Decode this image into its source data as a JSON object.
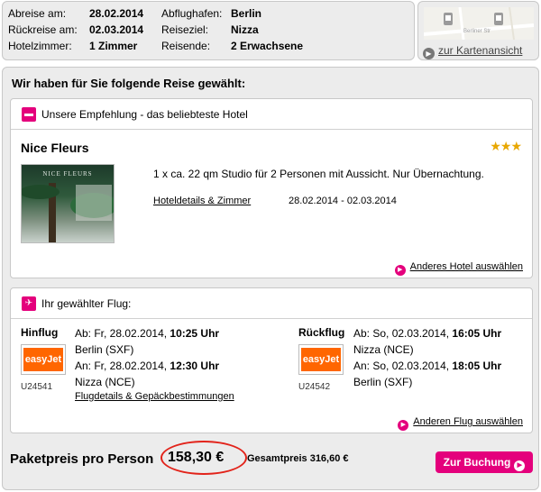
{
  "summary": {
    "depart_label": "Abreise am:",
    "depart_value": "28.02.2014",
    "airport_label": "Abflughafen:",
    "airport_value": "Berlin",
    "return_label": "Rückreise am:",
    "return_value": "02.03.2014",
    "dest_label": "Reiseziel:",
    "dest_value": "Nizza",
    "rooms_label": "Hotelzimmer:",
    "rooms_value": "1 Zimmer",
    "travelers_label": "Reisende:",
    "travelers_value": "2 Erwachsene"
  },
  "map": {
    "street": "Berliner Str",
    "link": "zur Kartenansicht"
  },
  "main": {
    "title": "Wir haben für Sie folgende Reise gewählt:"
  },
  "hotel": {
    "heading": "Unsere Empfehlung - das beliebteste Hotel",
    "name": "Nice Fleurs",
    "stars": "★★★",
    "stars_value": 3,
    "image_caption": "NICE FLEURS",
    "description": "1 x ca. 22 qm Studio für 2 Personen mit Aussicht. Nur Übernachtung.",
    "details_link": "Hoteldetails & Zimmer",
    "dates": "28.02.2014 - 02.03.2014",
    "alt_link": "Anderes Hotel auswählen"
  },
  "flight": {
    "heading": "Ihr gewählter Flug:",
    "outbound": {
      "label": "Hinflug",
      "airline": "easyJet",
      "number": "U24541",
      "dep_prefix": "Ab: Fr, 28.02.2014, ",
      "dep_time": "10:25 Uhr",
      "dep_airport": "Berlin (SXF)",
      "arr_prefix": "An: Fr, 28.02.2014, ",
      "arr_time": "12:30 Uhr",
      "arr_airport": "Nizza (NCE)",
      "details_link": "Flugdetails & Gepäckbestimmungen"
    },
    "return": {
      "label": "Rückflug",
      "airline": "easyJet",
      "number": "U24542",
      "dep_prefix": "Ab: So, 02.03.2014, ",
      "dep_time": "16:05 Uhr",
      "dep_airport": "Nizza (NCE)",
      "arr_prefix": "An: So, 02.03.2014, ",
      "arr_time": "18:05 Uhr",
      "arr_airport": "Berlin (SXF)"
    },
    "alt_link": "Anderen Flug auswählen"
  },
  "price": {
    "label": "Paketpreis pro Person",
    "amount": "158,30 €",
    "total": "Gesamtpreis 316,60 €",
    "book_button": "Zur Buchung"
  },
  "colors": {
    "accent": "#e4007c",
    "highlight_ring": "#e2231a",
    "stars": "#e8a700",
    "easyjet": "#ff6600"
  }
}
